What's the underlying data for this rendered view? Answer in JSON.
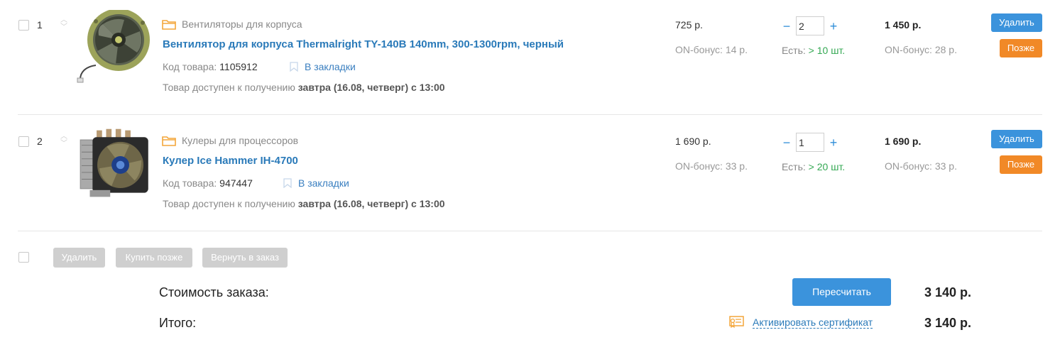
{
  "items": [
    {
      "index": "1",
      "category": "Вентиляторы для корпуса",
      "title": "Вентилятор для корпуса Thermalright TY-140B 140mm, 300-1300rpm, черный",
      "code_label": "Код товара:",
      "code": "1105912",
      "bookmark": "В закладки",
      "avail_prefix": "Товар доступен к получению",
      "avail_bold": "завтра (16.08, четверг) с 13:00",
      "price": "725 р.",
      "bonus": "ON-бонус: 14 р.",
      "qty": "2",
      "stock_label": "Есть:",
      "stock_value": "> 10 шт.",
      "total": "1 450 р.",
      "total_bonus": "ON-бонус: 28 р."
    },
    {
      "index": "2",
      "category": "Кулеры для процессоров",
      "title": "Кулер Ice Hammer IH-4700",
      "code_label": "Код товара:",
      "code": "947447",
      "bookmark": "В закладки",
      "avail_prefix": "Товар доступен к получению",
      "avail_bold": "завтра (16.08, четверг) с 13:00",
      "price": "1 690 р.",
      "bonus": "ON-бонус: 33 р.",
      "qty": "1",
      "stock_label": "Есть:",
      "stock_value": "> 20 шт.",
      "total": "1 690 р.",
      "total_bonus": "ON-бонус: 33 р."
    }
  ],
  "row_actions": {
    "delete": "Удалить",
    "later": "Позже"
  },
  "qty_controls": {
    "minus": "−",
    "plus": "+"
  },
  "bulk_actions": {
    "delete": "Удалить",
    "buy_later": "Купить позже",
    "return": "Вернуть в заказ"
  },
  "summary": {
    "order_cost_label": "Стоимость заказа:",
    "order_cost": "3 140 р.",
    "recalc": "Пересчитать",
    "total_label": "Итого:",
    "certificate": "Активировать сертификат",
    "total": "3 140 р."
  },
  "colors": {
    "link": "#2a7ab9",
    "primary": "#3b93dc",
    "later": "#f18927",
    "in_stock": "#34a853",
    "disabled": "#cfcfcf"
  }
}
